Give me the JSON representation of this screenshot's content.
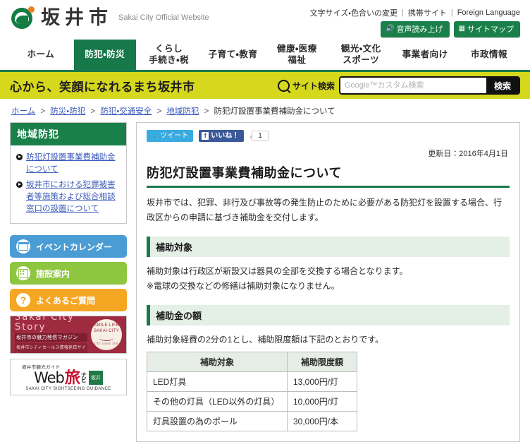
{
  "header": {
    "logo_icon": "sakai-city-swirl-logo",
    "brand_name": "坂井市",
    "brand_sub": "Sakai City Official Website",
    "util_links": [
      {
        "label": "文字サイズ・色合いの変更"
      },
      {
        "label": "携帯サイト"
      },
      {
        "label": "Foreign Language"
      }
    ],
    "util_separator": "|",
    "util_buttons": [
      {
        "label": "音声読み上げ",
        "icon": "speaker-icon"
      },
      {
        "label": "サイトマップ",
        "icon": "sitemap-icon"
      }
    ]
  },
  "nav": {
    "items": [
      {
        "line1": "ホーム",
        "line2": "",
        "active": false
      },
      {
        "line1": "防犯・防災",
        "line2": "",
        "active": true
      },
      {
        "line1": "くらし",
        "line2": "手続き・税",
        "active": false
      },
      {
        "line1": "子育て・教育",
        "line2": "",
        "active": false
      },
      {
        "line1": "健康・医療",
        "line2": "福祉",
        "active": false
      },
      {
        "line1": "観光・文化",
        "line2": "スポーツ",
        "active": false
      },
      {
        "line1": "事業者向け",
        "line2": "",
        "active": false
      },
      {
        "line1": "市政情報",
        "line2": "",
        "active": false
      }
    ]
  },
  "catchbar": {
    "text": "心から、笑顔になれるまち坂井市",
    "search_label": "サイト検索",
    "search_icon": "magnifier-icon",
    "search_placeholder": "Google™カスタム検索",
    "search_value": "",
    "search_button": "検索"
  },
  "breadcrumb": {
    "items": [
      {
        "label": "ホーム",
        "link": true
      },
      {
        "label": "防災・防犯",
        "link": true
      },
      {
        "label": "防犯・交通安全",
        "link": true
      },
      {
        "label": "地域防犯",
        "link": true
      },
      {
        "label": "防犯灯設置事業費補助金について",
        "link": false
      }
    ],
    "separator": ">"
  },
  "sidebar": {
    "panel_title": "地域防犯",
    "links": [
      {
        "label": "防犯灯設置事業費補助金について"
      },
      {
        "label": "坂井市における犯罪被害者等施策および総合相談窓口の設置について"
      }
    ],
    "buttons": [
      {
        "label": "イベントカレンダー",
        "color": "#4a9cd4",
        "icon": "calendar-icon"
      },
      {
        "label": "施設案内",
        "color": "#8dc63f",
        "icon": "building-icon"
      },
      {
        "label": "よくあるご質問",
        "color": "#f5a623",
        "icon": "question-icon"
      }
    ],
    "banner_story": {
      "title": "Sakai City Story",
      "line2": "坂井市の魅力発信マガジン",
      "line3": "坂井市シティセールス情報発信サイト",
      "circle_line1": "SMILE LIFE",
      "circle_line2": "SAKAI-CITY",
      "circle_sub": "city sales site"
    },
    "banner_web": {
      "top": "坂井市観光ガイド",
      "web": "Web",
      "tabi": "旅",
      "navi1": "ナ",
      "navi2": "ビ",
      "seal1": "坂",
      "seal2": "井",
      "bottom": "SAKAI CITY SIGHTSEEING GUIDANCE"
    }
  },
  "content": {
    "twitter_label": "ツイート",
    "twitter_icon": "twitter-bird-icon",
    "facebook_label": "いいね！",
    "facebook_icon": "facebook-f-icon",
    "facebook_count": "1",
    "update_date": "更新日：2016年4月1日",
    "title": "防犯灯設置事業費補助金について",
    "intro": "坂井市では、犯罪、非行及び事故等の発生防止のために必要がある防犯灯を設置する場合、行政区からの申請に基づき補助金を交付します。",
    "section1": {
      "heading": "補助対象",
      "line1": "補助対象は行政区が新設又は器具の全部を交換する場合となります。",
      "line2": "※電球の交換などの修繕は補助対象になりません。"
    },
    "section2": {
      "heading": "補助金の額",
      "line1": "補助対象経費の2分の1とし、補助限度額は下記のとおりです。",
      "table": {
        "headers": [
          "補助対象",
          "補助限度額"
        ],
        "rows": [
          [
            "LED灯具",
            "13,000円/灯"
          ],
          [
            "その他の灯具（LED以外の灯具）",
            "10,000円/灯"
          ],
          [
            "灯具設置の為のポール",
            "30,000円/本"
          ]
        ]
      }
    }
  }
}
